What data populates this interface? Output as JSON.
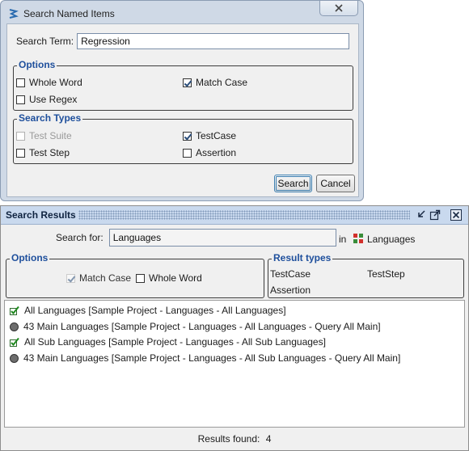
{
  "dialog": {
    "title": "Search Named Items",
    "search_term_label": "Search Term:",
    "search_term_value": "Regression",
    "options_legend": "Options",
    "options": [
      {
        "label": "Whole Word",
        "checked": false
      },
      {
        "label": "Match Case",
        "checked": true
      },
      {
        "label": "Use Regex",
        "checked": false
      }
    ],
    "types_legend": "Search Types",
    "types": [
      {
        "label": "Test Suite",
        "checked": false,
        "disabled": true
      },
      {
        "label": "TestCase",
        "checked": true,
        "disabled": false
      },
      {
        "label": "Test Step",
        "checked": false,
        "disabled": false
      },
      {
        "label": "Assertion",
        "checked": false,
        "disabled": false
      }
    ],
    "search_button": "Search",
    "cancel_button": "Cancel"
  },
  "results_panel": {
    "title": "Search Results",
    "search_for_label": "Search for:",
    "search_for_value": "Languages",
    "in_label": "in",
    "scope_label": "Languages",
    "options_legend": "Options",
    "options": [
      {
        "label": "Match Case",
        "checked": true,
        "disabled": true
      },
      {
        "label": "Whole Word",
        "checked": false,
        "disabled": false
      }
    ],
    "result_types_legend": "Result types",
    "result_types": [
      "TestCase",
      "TestStep",
      "Assertion"
    ],
    "results": [
      {
        "text": "All Languages [Sample Project - Languages - All Languages]",
        "icon": "testcase-check-icon"
      },
      {
        "text": "43 Main Languages [Sample Project - Languages - All Languages - Query All Main]",
        "icon": "teststep-circle-icon"
      },
      {
        "text": "All Sub Languages [Sample Project - Languages - All Sub Languages]",
        "icon": "testcase-check-icon"
      },
      {
        "text": "43 Main Languages [Sample Project - Languages - All Sub Languages - Query All Main]",
        "icon": "teststep-circle-icon"
      }
    ],
    "results_found_label": "Results found:",
    "results_found_count": "4"
  },
  "colors": {
    "accent_legend": "#1e4f9c",
    "panel_header": "#c9d9ee",
    "dialog_frame": "#cfd9e6"
  }
}
